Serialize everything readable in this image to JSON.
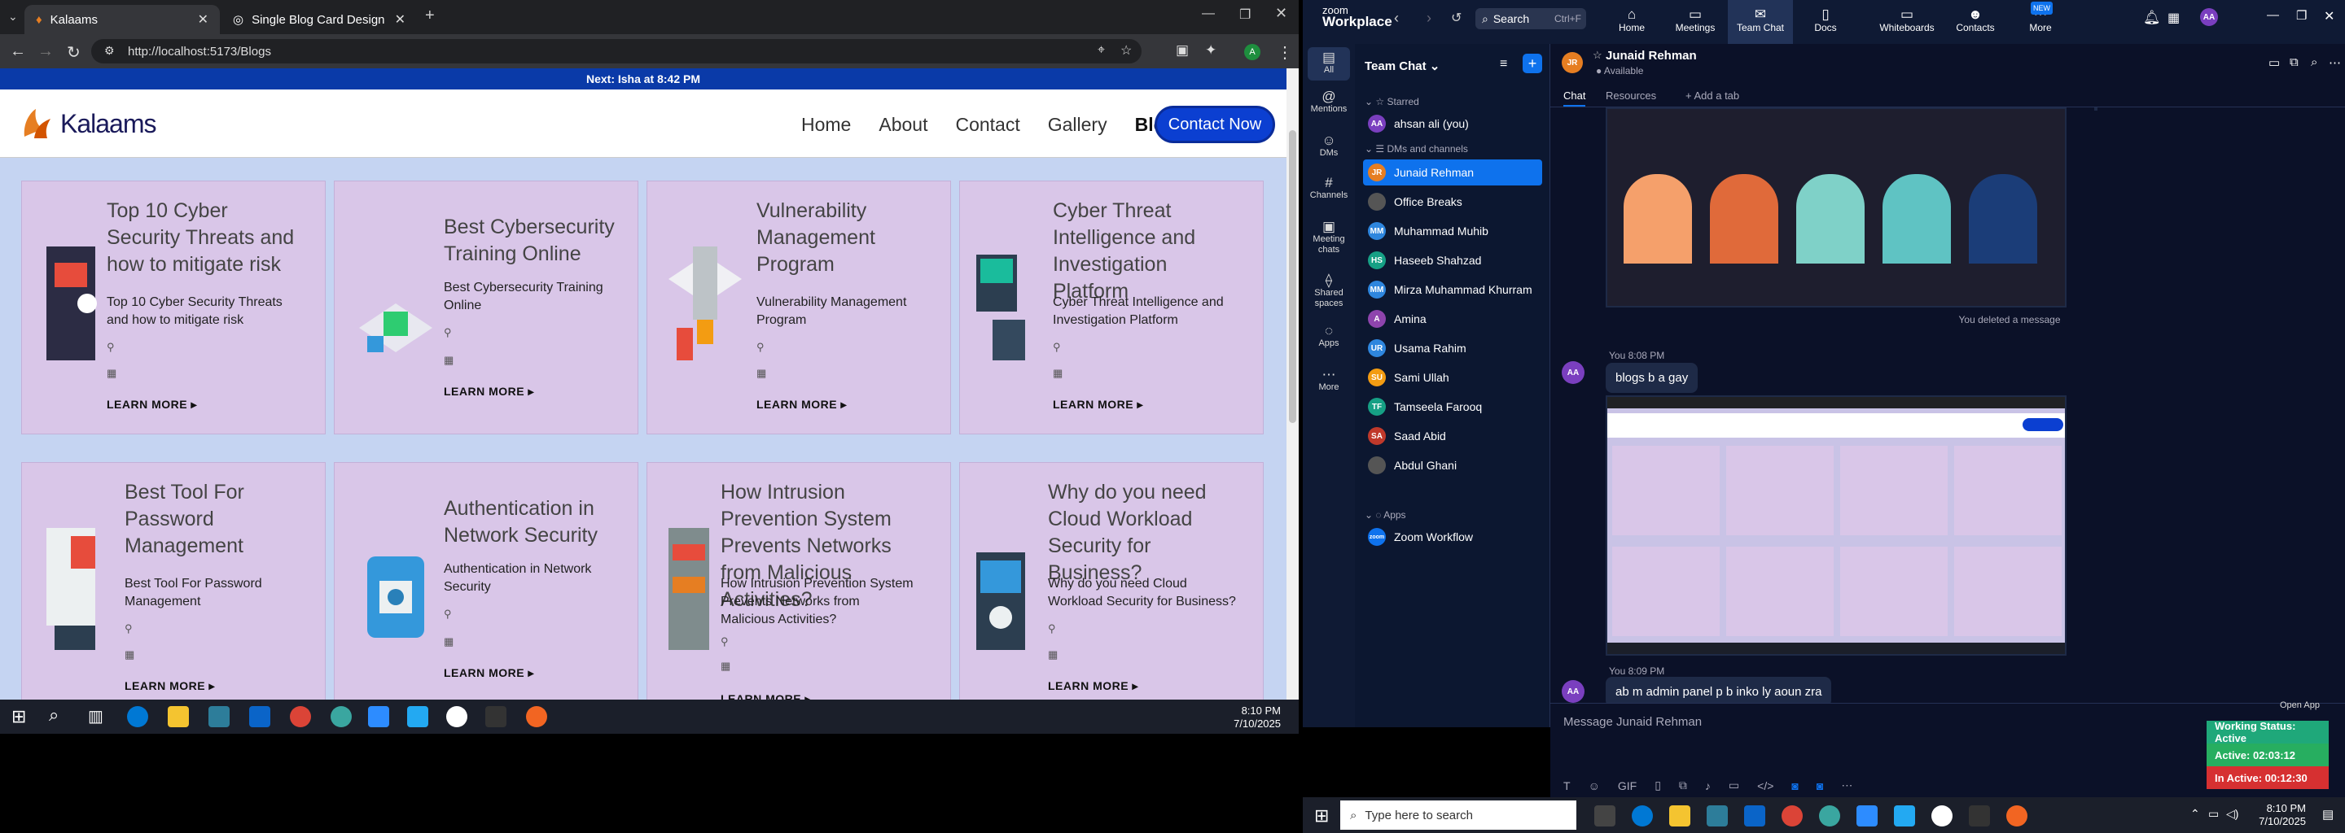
{
  "browser": {
    "tabs": [
      {
        "label": "Kalaams"
      },
      {
        "label": "Single Blog Card Design"
      }
    ],
    "url": "http://localhost:5173/Blogs",
    "new_tab": "+"
  },
  "site": {
    "announcement": "Next: Isha at 8:42 PM",
    "logo_text": "Kalaams",
    "nav": [
      "Home",
      "About",
      "Contact",
      "Gallery",
      "Blogs"
    ],
    "cta": "Contact Now",
    "cards": [
      {
        "title": "Top 10 Cyber Security Threats and how to mitigate risk",
        "desc": "Top 10 Cyber Security Threats and how to mitigate risk",
        "more": "LEARN MORE ▸"
      },
      {
        "title": "Best Cybersecurity Training Online",
        "desc": "Best Cybersecurity Training Online",
        "more": "LEARN MORE ▸"
      },
      {
        "title": "Vulnerability Management Program",
        "desc": "Vulnerability Management Program",
        "more": "LEARN MORE ▸"
      },
      {
        "title": "Cyber Threat Intelligence and Investigation Platform",
        "desc": "Cyber Threat Intelligence and Investigation Platform",
        "more": "LEARN MORE ▸"
      },
      {
        "title": "Best Tool For Password Management",
        "desc": "Best Tool For Password Management",
        "more": "LEARN MORE ▸"
      },
      {
        "title": "Authentication in Network Security",
        "desc": "Authentication in Network Security",
        "more": "LEARN MORE ▸"
      },
      {
        "title": "How Intrusion Prevention System Prevents Networks from Malicious Activities?",
        "desc": "How Intrusion Prevention System Prevents Networks from Malicious Activities?",
        "more": "LEARN MORE ▸"
      },
      {
        "title": "Why do you need Cloud Workload Security for Business?",
        "desc": "Why do you need Cloud Workload Security for Business?",
        "more": "LEARN MORE ▸"
      }
    ]
  },
  "taskbar_left": {
    "time": "8:10 PM",
    "date": "7/10/2025"
  },
  "zoom": {
    "brand_top": "zoom",
    "brand": "Workplace",
    "search": "Search",
    "search_shortcut": "Ctrl+F",
    "tabs": [
      "Home",
      "Meetings",
      "Team Chat",
      "Docs",
      "Whiteboards",
      "Contacts",
      "More"
    ],
    "new_badge": "NEW",
    "user_initials": "AA",
    "rail": [
      "All",
      "Mentions",
      "DMs",
      "Channels",
      "Meeting chats",
      "Shared spaces",
      "Apps",
      "More"
    ],
    "list_title": "Team Chat",
    "sections": {
      "starred": "Starred",
      "dms": "DMs and channels",
      "apps": "Apps"
    },
    "starred": [
      {
        "name": "ahsan ali (you)",
        "initials": "AA",
        "color": "#7a3fbf"
      }
    ],
    "contacts": [
      {
        "name": "Junaid Rehman",
        "initials": "JR",
        "color": "#e67e22"
      },
      {
        "name": "Office Breaks",
        "initials": "",
        "color": "#555"
      },
      {
        "name": "Muhammad Muhib",
        "initials": "MM",
        "color": "#2e86de"
      },
      {
        "name": "Haseeb Shahzad",
        "initials": "HS",
        "color": "#16a085"
      },
      {
        "name": "Mirza Muhammad Khurram",
        "initials": "MM",
        "color": "#2e86de"
      },
      {
        "name": "Amina",
        "initials": "A",
        "color": "#8e44ad"
      },
      {
        "name": "Usama Rahim",
        "initials": "UR",
        "color": "#2e86de"
      },
      {
        "name": "Sami Ullah",
        "initials": "SU",
        "color": "#f39c12"
      },
      {
        "name": "Tamseela Farooq",
        "initials": "TF",
        "color": "#16a085"
      },
      {
        "name": "Saad Abid",
        "initials": "SA",
        "color": "#c0392b"
      },
      {
        "name": "Abdul Ghani",
        "initials": "",
        "color": "#555"
      }
    ],
    "apps": [
      {
        "name": "Zoom Workflow",
        "initials": "zoom",
        "color": "#0e72ed"
      }
    ],
    "chat": {
      "name": "Junaid Rehman",
      "initials": "JR",
      "status": "Available",
      "tabs": [
        "Chat",
        "Resources",
        "+ Add a tab"
      ],
      "deleted": "You deleted a message",
      "msg1_meta": "You 8:08 PM",
      "msg1": "blogs b a gay",
      "msg2_meta": "You 8:09 PM",
      "msg2": "ab m admin panel p b inko ly aoun zra",
      "input_placeholder": "Message Junaid Rehman",
      "open_app": "Open App"
    },
    "status_badges": [
      {
        "label": "Working Status: Active",
        "color": "#1fa87a"
      },
      {
        "label": "Active: 02:03:12",
        "color": "#27ae60"
      },
      {
        "label": "In Active: 00:12:30",
        "color": "#d63031"
      }
    ]
  },
  "taskbar_right": {
    "search": "Type here to search",
    "time": "8:10 PM",
    "date": "7/10/2025"
  }
}
